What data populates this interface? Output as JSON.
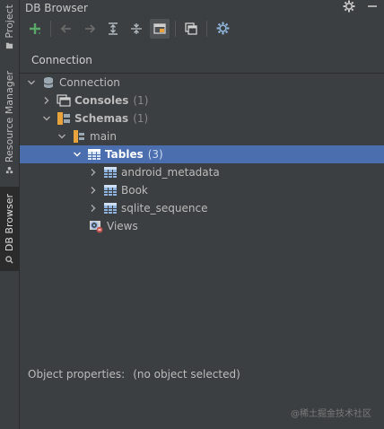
{
  "sidebar": {
    "tabs": [
      {
        "label": "Project"
      },
      {
        "label": "Resource Manager"
      },
      {
        "label": "DB Browser"
      }
    ]
  },
  "window": {
    "title": "DB Browser"
  },
  "toolbar": {
    "icons": [
      "add-icon",
      "back-icon",
      "forward-icon",
      "expand-all-icon",
      "collapse-all-icon",
      "toggle-view-icon",
      "open-console-icon",
      "settings-icon"
    ]
  },
  "connection_header": "Connection",
  "tree": {
    "connection": {
      "label": "Connection"
    },
    "consoles": {
      "label": "Consoles",
      "count": "(1)"
    },
    "schemas": {
      "label": "Schemas",
      "count": "(1)"
    },
    "main": {
      "label": "main"
    },
    "tables": {
      "label": "Tables",
      "count": "(3)"
    },
    "table_items": [
      "android_metadata",
      "Book",
      "sqlite_sequence"
    ],
    "views": {
      "label": "Views"
    }
  },
  "properties": {
    "label": "Object properties:",
    "value": "(no object selected)"
  },
  "watermark": "@稀土掘金技术社区",
  "colors": {
    "background": "#3c3f41",
    "selection": "#4b6eaf",
    "table_icon": "#5f8dd3",
    "schema_icon": "#f0a732",
    "add_green": "#59a869"
  }
}
